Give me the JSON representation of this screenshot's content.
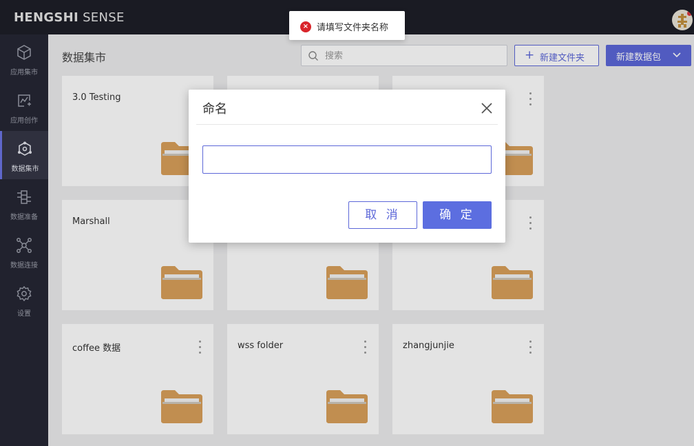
{
  "app": {
    "logo_bold": "HENGSHI",
    "logo_light": "SENSE"
  },
  "sidebar": {
    "items": [
      {
        "label": "应用集市",
        "icon": "cube-icon",
        "active": false
      },
      {
        "label": "应用创作",
        "icon": "chart-edit-icon",
        "active": false
      },
      {
        "label": "数据集市",
        "icon": "data-market-icon",
        "active": true
      },
      {
        "label": "数据准备",
        "icon": "data-prep-icon",
        "active": false
      },
      {
        "label": "数据连接",
        "icon": "data-connect-icon",
        "active": false
      },
      {
        "label": "设置",
        "icon": "gear-icon",
        "active": false
      }
    ]
  },
  "main": {
    "title": "数据集市",
    "search": {
      "placeholder": "搜索",
      "value": ""
    },
    "new_folder_label": "新建文件夹",
    "new_package_label": "新建数据包",
    "cards": [
      {
        "name": "3.0 Testing"
      },
      {
        "name": ""
      },
      {
        "name": ""
      },
      {
        "name": "Marshall"
      },
      {
        "name": ""
      },
      {
        "name": ""
      },
      {
        "name": "coffee 数据"
      },
      {
        "name": "wss folder"
      },
      {
        "name": "zhangjunjie"
      }
    ]
  },
  "toast": {
    "message": "请填写文件夹名称",
    "type": "error"
  },
  "modal": {
    "title": "命名",
    "input_value": "",
    "cancel_label": "取 消",
    "confirm_label": "确 定"
  },
  "colors": {
    "accent": "#5c67d8",
    "error": "#d9252b",
    "folder": "#d9a05a",
    "topbar": "#1e1f28",
    "sidebar": "#262734"
  }
}
